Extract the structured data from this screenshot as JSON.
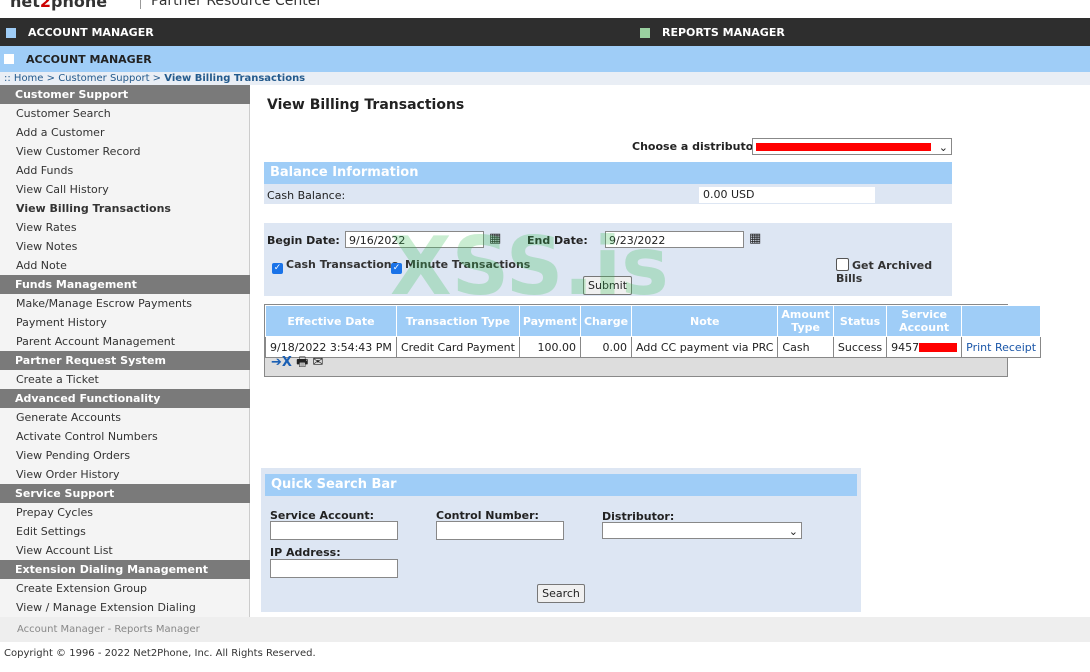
{
  "header": {
    "logo_a": "net",
    "logo_b": "2",
    "logo_c": "phone",
    "tagline": "Partner Resource Center"
  },
  "topnav": [
    {
      "label": "ACCOUNT MANAGER",
      "color": "#9fcdf7"
    },
    {
      "label": "REPORTS MANAGER",
      "color": "#9ad0a0"
    }
  ],
  "subnav": "ACCOUNT MANAGER",
  "breadcrumb": {
    "prefix": ":: ",
    "home": "Home",
    "sep": " > ",
    "section": "Customer Support",
    "current": "View Billing Transactions"
  },
  "sidebar": [
    {
      "header": "Customer Support",
      "items": [
        "Customer Search",
        "Add a Customer",
        "View Customer Record",
        "Add Funds",
        "View Call History",
        "View Billing Transactions",
        "View Rates",
        "View Notes",
        "Add Note"
      ]
    },
    {
      "header": "Funds Management",
      "items": [
        "Make/Manage Escrow Payments",
        "Payment History",
        "Parent Account Management"
      ]
    },
    {
      "header": "Partner Request System",
      "items": [
        "Create a Ticket"
      ]
    },
    {
      "header": "Advanced Functionality",
      "items": [
        "Generate Accounts",
        "Activate Control Numbers",
        "View Pending Orders",
        "View Order History"
      ]
    },
    {
      "header": "Service Support",
      "items": [
        "Prepay Cycles",
        "Edit Settings",
        "View Account List"
      ]
    },
    {
      "header": "Extension Dialing Management",
      "items": [
        "Create Extension Group",
        "View / Manage Extension Dialing"
      ]
    }
  ],
  "page_title": "View Billing Transactions",
  "distributor_label": "Choose a distributor:",
  "balance": {
    "title": "Balance Information",
    "label": "Cash Balance:",
    "value": "0.00 USD"
  },
  "filter": {
    "begin_label": "Begin Date:",
    "begin": "9/16/2022",
    "end_label": "End Date:",
    "end": "9/23/2022",
    "cash": "Cash Transactions",
    "minute": "Minute Transactions",
    "archived": "Get Archived Bills",
    "submit": "Submit"
  },
  "table": {
    "headers": [
      "Effective Date",
      "Transaction Type",
      "Payment",
      "Charge",
      "Note",
      "Amount Type",
      "Status",
      "Service Account",
      ""
    ],
    "rows": [
      [
        "9/18/2022 3:54:43 PM",
        "Credit Card Payment",
        "100.00",
        "0.00",
        "Add CC payment via PRC",
        "Cash",
        "Success",
        "9457",
        "Print Receipt"
      ]
    ]
  },
  "quick": {
    "title": "Quick Search Bar",
    "service": "Service Account:",
    "control": "Control Number:",
    "distributor": "Distributor:",
    "ip": "IP Address:",
    "search": "Search"
  },
  "footer": {
    "links": "Account Manager - Reports Manager",
    "copyright": "Copyright © 1996 - 2022 Net2Phone, Inc. All Rights Reserved."
  },
  "watermark": "XSS.is"
}
